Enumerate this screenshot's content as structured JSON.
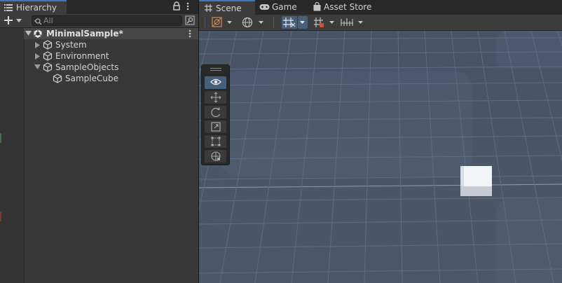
{
  "hierarchy": {
    "tab_label": "Hierarchy",
    "search_placeholder": "All",
    "scene_name": "MinimalSample*",
    "items": [
      {
        "label": "System",
        "expanded": false
      },
      {
        "label": "Environment",
        "expanded": false
      },
      {
        "label": "SampleObjects",
        "expanded": true
      },
      {
        "label": "SampleCube",
        "child": true
      }
    ]
  },
  "scene": {
    "tabs": [
      {
        "label": "Scene",
        "icon": "hash-icon"
      },
      {
        "label": "Game",
        "icon": "gamepad-icon"
      },
      {
        "label": "Asset Store",
        "icon": "shopping-bag-icon"
      }
    ],
    "tools": [
      "view-tool",
      "move-tool",
      "rotate-tool",
      "scale-tool",
      "rect-tool",
      "transform-tool"
    ],
    "active_tool": "view-tool"
  },
  "colors": {
    "accent": "#3a79bb",
    "panel": "#383838",
    "sky": "#4b5668",
    "grid": "#5e6a7c",
    "selected_toggle": "#46607c"
  }
}
